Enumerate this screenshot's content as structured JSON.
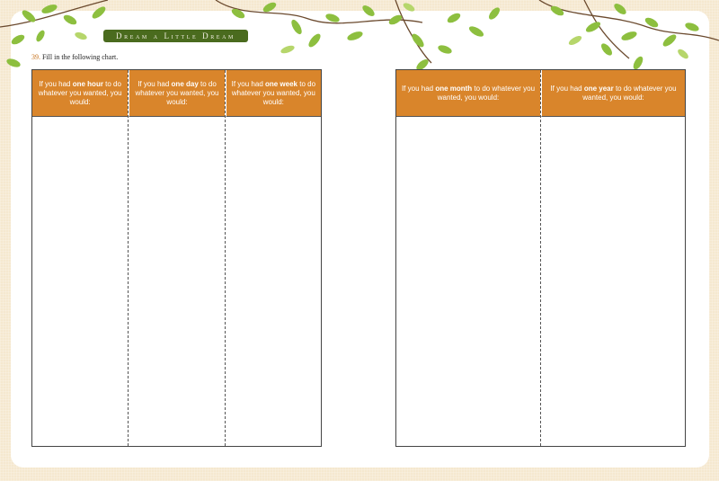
{
  "header": {
    "banner": "Dream a Little Dream"
  },
  "instruction": {
    "number": "39.",
    "text": "Fill in the following chart."
  },
  "colors": {
    "accent": "#d9852b",
    "banner": "#4a6b1e",
    "leaf": "#8dbf3f",
    "background": "#f5e8cf"
  },
  "left_chart": {
    "columns": [
      {
        "pre": "If you had ",
        "bold": "one hour",
        "post": " to do whatever you wanted, you would:"
      },
      {
        "pre": "If you had ",
        "bold": "one day",
        "post": " to do whatever you wanted, you would:"
      },
      {
        "pre": "If you had ",
        "bold": "one week",
        "post": " to do whatever you wanted, you would:"
      }
    ]
  },
  "right_chart": {
    "columns": [
      {
        "pre": "If you had ",
        "bold": "one month",
        "post": " to do whatever you wanted, you would:"
      },
      {
        "pre": "If you had ",
        "bold": "one year",
        "post": " to do whatever you wanted, you would:"
      }
    ]
  }
}
